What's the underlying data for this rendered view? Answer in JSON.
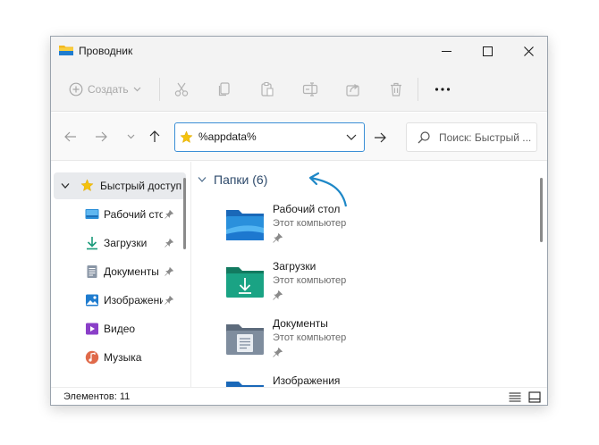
{
  "window": {
    "title": "Проводник",
    "controls": {
      "minimize": "minimize",
      "maximize": "maximize",
      "close": "close"
    }
  },
  "toolbar": {
    "new_label": "Создать",
    "buttons": [
      "cut-icon",
      "copy-icon",
      "paste-icon",
      "rename-icon",
      "share-icon",
      "delete-icon",
      "more-icon"
    ]
  },
  "address": {
    "value": "%appdata%",
    "search_placeholder": "Поиск: Быстрый ..."
  },
  "sidebar": {
    "quick_access_label": "Быстрый доступ",
    "items": [
      {
        "label": "Рабочий стол",
        "icon": "desktop-icon",
        "pinned": true
      },
      {
        "label": "Загрузки",
        "icon": "downloads-icon",
        "pinned": true
      },
      {
        "label": "Документы",
        "icon": "documents-icon",
        "pinned": true
      },
      {
        "label": "Изображения",
        "icon": "pictures-icon",
        "pinned": true
      },
      {
        "label": "Видео",
        "icon": "video-icon",
        "pinned": false
      },
      {
        "label": "Музыка",
        "icon": "music-icon",
        "pinned": false
      }
    ]
  },
  "content": {
    "group_title": "Папки (6)",
    "folders": [
      {
        "name": "Рабочий стол",
        "location": "Этот компьютер"
      },
      {
        "name": "Загрузки",
        "location": "Этот компьютер"
      },
      {
        "name": "Документы",
        "location": "Этот компьютер"
      },
      {
        "name": "Изображения",
        "location": ""
      }
    ]
  },
  "status": {
    "items_text": "Элементов: 11"
  },
  "colors": {
    "accent": "#3b8fd6",
    "star": "#f4c20d",
    "folder_blue": "#1f7ccf",
    "folder_green": "#1a9a7a",
    "arrow": "#1e88c7"
  }
}
